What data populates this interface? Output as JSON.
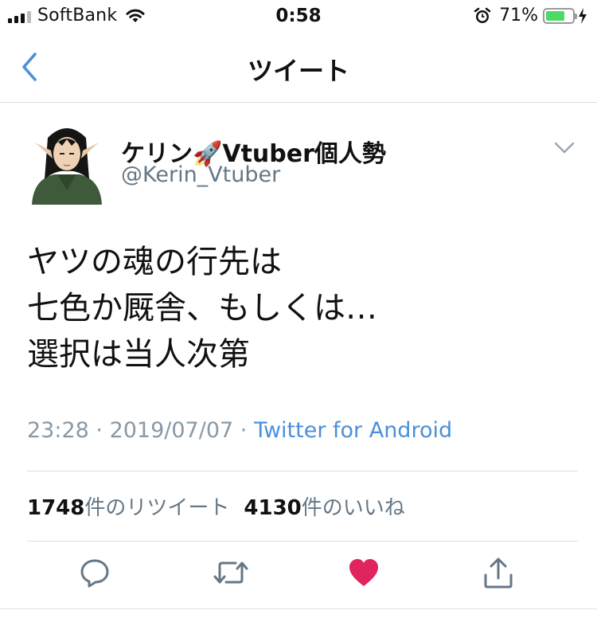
{
  "status_bar": {
    "carrier": "SoftBank",
    "time": "0:58",
    "battery_percent": "71%",
    "battery_level": 0.71,
    "icons": [
      "signal-icon",
      "wifi-icon",
      "alarm-icon",
      "battery-icon",
      "charging-bolt-icon"
    ]
  },
  "nav": {
    "back_icon": "chevron-left-icon",
    "title": "ツイート"
  },
  "tweet": {
    "author": {
      "display_name": "ケリン🚀Vtuber個人勢",
      "handle": "@Kerin_Vtuber"
    },
    "text_lines": [
      "ヤツの魂の行先は",
      "七色か厩舎、もしくは…",
      "選択は当人次第"
    ],
    "time": "23:28",
    "separator": " · ",
    "date": "2019/07/07",
    "source": "Twitter for Android",
    "retweet_count": "1748",
    "retweet_label": "件のリツイート",
    "like_count": "4130",
    "like_label": "件のいいね"
  },
  "actions": [
    {
      "name": "reply-icon"
    },
    {
      "name": "retweet-icon"
    },
    {
      "name": "like-icon",
      "color": "#e0245e",
      "active": true
    },
    {
      "name": "share-icon"
    }
  ],
  "colors": {
    "accent": "#4a90d9",
    "like": "#e0245e",
    "battery": "#4cd964",
    "secondary_text": "#657786"
  }
}
